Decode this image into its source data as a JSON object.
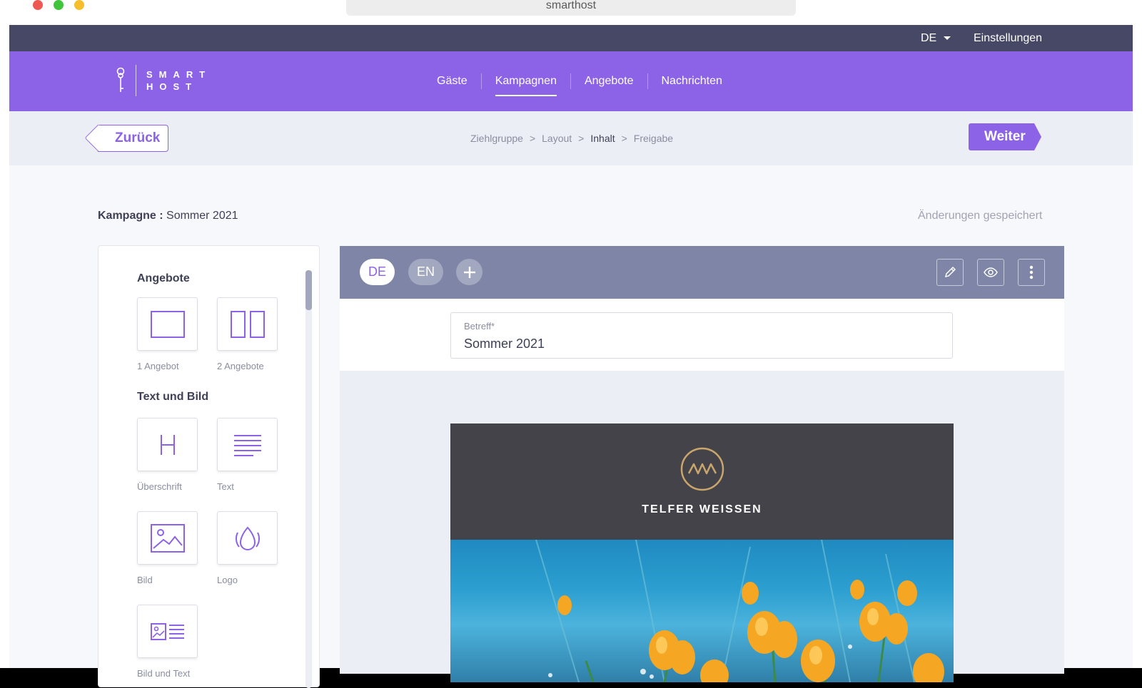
{
  "browser": {
    "url_title": "smarthost"
  },
  "topbar": {
    "language": "DE",
    "settings_label": "Einstellungen"
  },
  "brand": {
    "logo_line1": "SMART",
    "logo_line2": "HOST"
  },
  "nav": {
    "items": [
      {
        "label": "Gäste",
        "active": false
      },
      {
        "label": "Kampagnen",
        "active": true
      },
      {
        "label": "Angebote",
        "active": false
      },
      {
        "label": "Nachrichten",
        "active": false
      }
    ]
  },
  "steps": {
    "back_label": "Zurück",
    "next_label": "Weiter",
    "breadcrumbs": [
      "Ziehlgruppe",
      "Layout",
      "Inhalt",
      "Freigabe"
    ],
    "current": "Inhalt",
    "separator": ">"
  },
  "campaign": {
    "label": "Kampagne :",
    "name": "Sommer 2021",
    "save_status": "Änderungen gespeichert"
  },
  "palette": {
    "sections": [
      {
        "title": "Angebote",
        "items": [
          {
            "label": "1 Angebot",
            "icon": "single-offer-icon"
          },
          {
            "label": "2 Angebote",
            "icon": "double-offer-icon"
          }
        ]
      },
      {
        "title": "Text und Bild",
        "items": [
          {
            "label": "Überschrift",
            "icon": "heading-icon"
          },
          {
            "label": "Text",
            "icon": "text-icon"
          },
          {
            "label": "Bild",
            "icon": "image-icon"
          },
          {
            "label": "Logo",
            "icon": "logo-icon"
          },
          {
            "label": "Bild und Text",
            "icon": "image-text-icon"
          }
        ]
      }
    ]
  },
  "editor": {
    "languages": [
      {
        "code": "DE",
        "active": true
      },
      {
        "code": "EN",
        "active": false
      }
    ],
    "tools": [
      "edit-icon",
      "preview-icon",
      "more-icon"
    ],
    "subject": {
      "label": "Betreff*",
      "value": "Sommer 2021"
    }
  },
  "email_preview": {
    "hotel_name": "TELFER WEISSEN"
  },
  "colors": {
    "primary": "#8c63e6",
    "topbar": "#464866",
    "editor_toolbar": "#7e85a6",
    "email_header": "#434349"
  }
}
